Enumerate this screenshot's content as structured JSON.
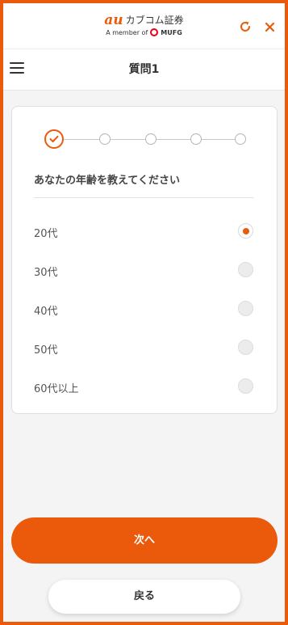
{
  "brand": {
    "logo_mark": "au",
    "name": "カブコム証券",
    "member_text": "A member of",
    "group_name": "MUFG"
  },
  "header": {
    "title": "質問1",
    "icons": {
      "menu": "hamburger-menu-icon",
      "refresh": "refresh-icon",
      "close": "close-icon"
    }
  },
  "stepper": {
    "total_steps": 5,
    "current_step": 1,
    "completed_steps": 1
  },
  "question": {
    "text": "あなたの年齢を教えてください",
    "options": [
      {
        "label": "20代",
        "selected": true
      },
      {
        "label": "30代",
        "selected": false
      },
      {
        "label": "40代",
        "selected": false
      },
      {
        "label": "50代",
        "selected": false
      },
      {
        "label": "60代以上",
        "selected": false
      }
    ]
  },
  "buttons": {
    "next": "次へ",
    "back": "戻る"
  },
  "colors": {
    "accent": "#eb5a0a",
    "mufg_red": "#e60012"
  }
}
